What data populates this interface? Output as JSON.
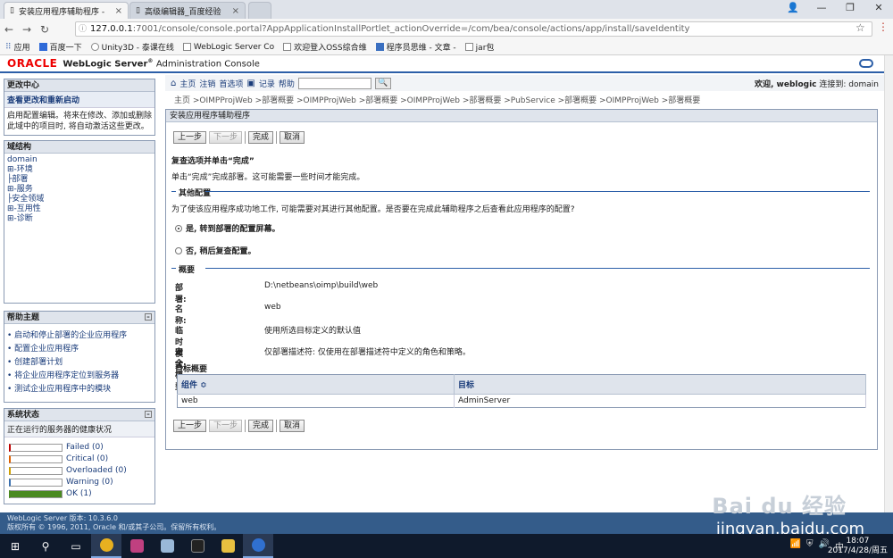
{
  "browser": {
    "tabs": [
      {
        "title": "安装应用程序辅助程序 -",
        "active": true
      },
      {
        "title": "高级编辑器_百度经验",
        "active": false
      }
    ],
    "url_host": "127.0.0.1",
    "url_rest": ":7001/console/console.portal?AppApplicationInstallPortlet_actionOverride=/com/bea/console/actions/app/install/saveIdentity",
    "bookmarks": [
      "应用",
      "百度一下",
      "Unity3D - 泰课在线",
      "WebLogic Server Co",
      "欢迎登入OSS综合维",
      "程序员思维 - 文章 -",
      "jar包"
    ]
  },
  "header": {
    "logo": "ORACLE",
    "product": "WebLogic Server",
    "product_suffix": "Administration Console"
  },
  "change_center": {
    "title": "更改中心",
    "link": "查看更改和重新启动",
    "text": "启用配置编辑。将来在修改、添加或删除此域中的项目时, 将自动激活这些更改。"
  },
  "domain_structure": {
    "title": "域结构",
    "items": [
      "domain",
      "⊞-环境",
      "├部署",
      "⊞-服务",
      "├安全领域",
      "⊞-互用性",
      "⊞-诊断"
    ]
  },
  "help_topics": {
    "title": "帮助主题",
    "items": [
      "启动和停止部署的企业应用程序",
      "配置企业应用程序",
      "创建部署计划",
      "将企业应用程序定位到服务器",
      "测试企业应用程序中的模块"
    ]
  },
  "system_status": {
    "title": "系统状态",
    "subtitle": "正在运行的服务器的健康状况",
    "rows": [
      {
        "label": "Failed (0)",
        "fill": 0,
        "color": "#c00000"
      },
      {
        "label": "Critical (0)",
        "fill": 0,
        "color": "#e06000"
      },
      {
        "label": "Overloaded (0)",
        "fill": 0,
        "color": "#d0a000"
      },
      {
        "label": "Warning (0)",
        "fill": 0,
        "color": "#3a70b0"
      },
      {
        "label": "OK (1)",
        "fill": 1,
        "color": "#4a8a20"
      }
    ]
  },
  "toolbar": {
    "home": "主页",
    "logout": "注销",
    "prefs": "首选项",
    "record": "记录",
    "help": "帮助",
    "welcome": "欢迎, weblogic",
    "connected": "连接到: domain"
  },
  "breadcrumb": "主页 >OIMPProjWeb >部署概要 >OIMPProjWeb >部署概要 >OIMPProjWeb >部署概要 >PubService >部署概要 >OIMPProjWeb >部署概要",
  "main": {
    "title": "安装应用程序辅助程序",
    "buttons": {
      "back": "上一步",
      "next": "下一步",
      "finish": "完成",
      "cancel": "取消"
    },
    "review_title": "复查选项并单击“完成”",
    "review_text": "单击“完成”完成部署。这可能需要一些时间才能完成。",
    "extra_section": "其他配置",
    "extra_question": "为了使该应用程序成功地工作, 可能需要对其进行其他配置。是否要在完成此辅助程序之后查看此应用程序的配置?",
    "option_yes": "是, 转到部署的配置屏幕。",
    "option_no": "否, 稍后复查配置。",
    "summary_section": "概要",
    "summary": [
      {
        "key": "部署:",
        "value": "D:\\netbeans\\oimp\\build\\web"
      },
      {
        "key": "名称:",
        "value": "web"
      },
      {
        "key": "临时模式:",
        "value": "使用所选目标定义的默认值"
      },
      {
        "key": "安全模型:",
        "value": "仅部署描述符: 仅使用在部署描述符中定义的角色和策略。"
      }
    ],
    "target_summary": "目标概要",
    "table": {
      "headers": [
        "组件",
        "目标"
      ],
      "rows": [
        [
          "web",
          "AdminServer"
        ]
      ]
    }
  },
  "footer": {
    "line1": "WebLogic Server 版本: 10.3.6.0",
    "line2": "版权所有 © 1996, 2011, Oracle 和/或其子公司。保留所有权利。"
  },
  "watermark": {
    "text1": "Bai du 经验",
    "text2": "jingyan.baidu.com"
  },
  "taskbar": {
    "time": "18:07",
    "date": "2017/4/28/周五"
  }
}
